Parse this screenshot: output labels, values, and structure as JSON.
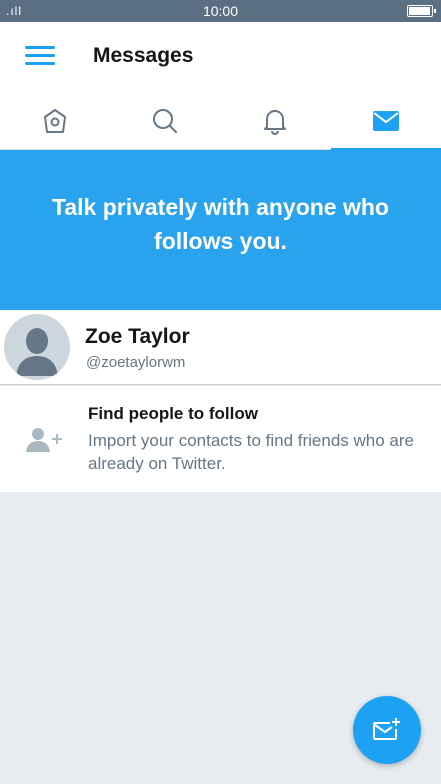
{
  "status_bar": {
    "signal": ".ıll",
    "time": "10:00",
    "battery_level": 0.95
  },
  "header": {
    "title": "Messages",
    "menu_icon": "hamburger-menu-icon"
  },
  "tabs": [
    {
      "name": "home",
      "icon": "home-icon",
      "active": false
    },
    {
      "name": "search",
      "icon": "search-icon",
      "active": false
    },
    {
      "name": "notifications",
      "icon": "bell-icon",
      "active": false
    },
    {
      "name": "messages",
      "icon": "envelope-icon",
      "active": true
    }
  ],
  "banner": {
    "text": "Talk privately with anyone who follows you."
  },
  "conversation": {
    "name": "Zoe Taylor",
    "handle": "@zoetaylorwm"
  },
  "find_people": {
    "title": "Find people to follow",
    "description": "Import your contacts to find friends who are already on Twitter."
  },
  "fab": {
    "icon": "new-message-icon"
  },
  "colors": {
    "accent": "#1da1f2",
    "banner": "#2aa3ef",
    "status_bar": "#5b6f83",
    "background": "#e6ecf0",
    "secondary_text": "#657786"
  }
}
